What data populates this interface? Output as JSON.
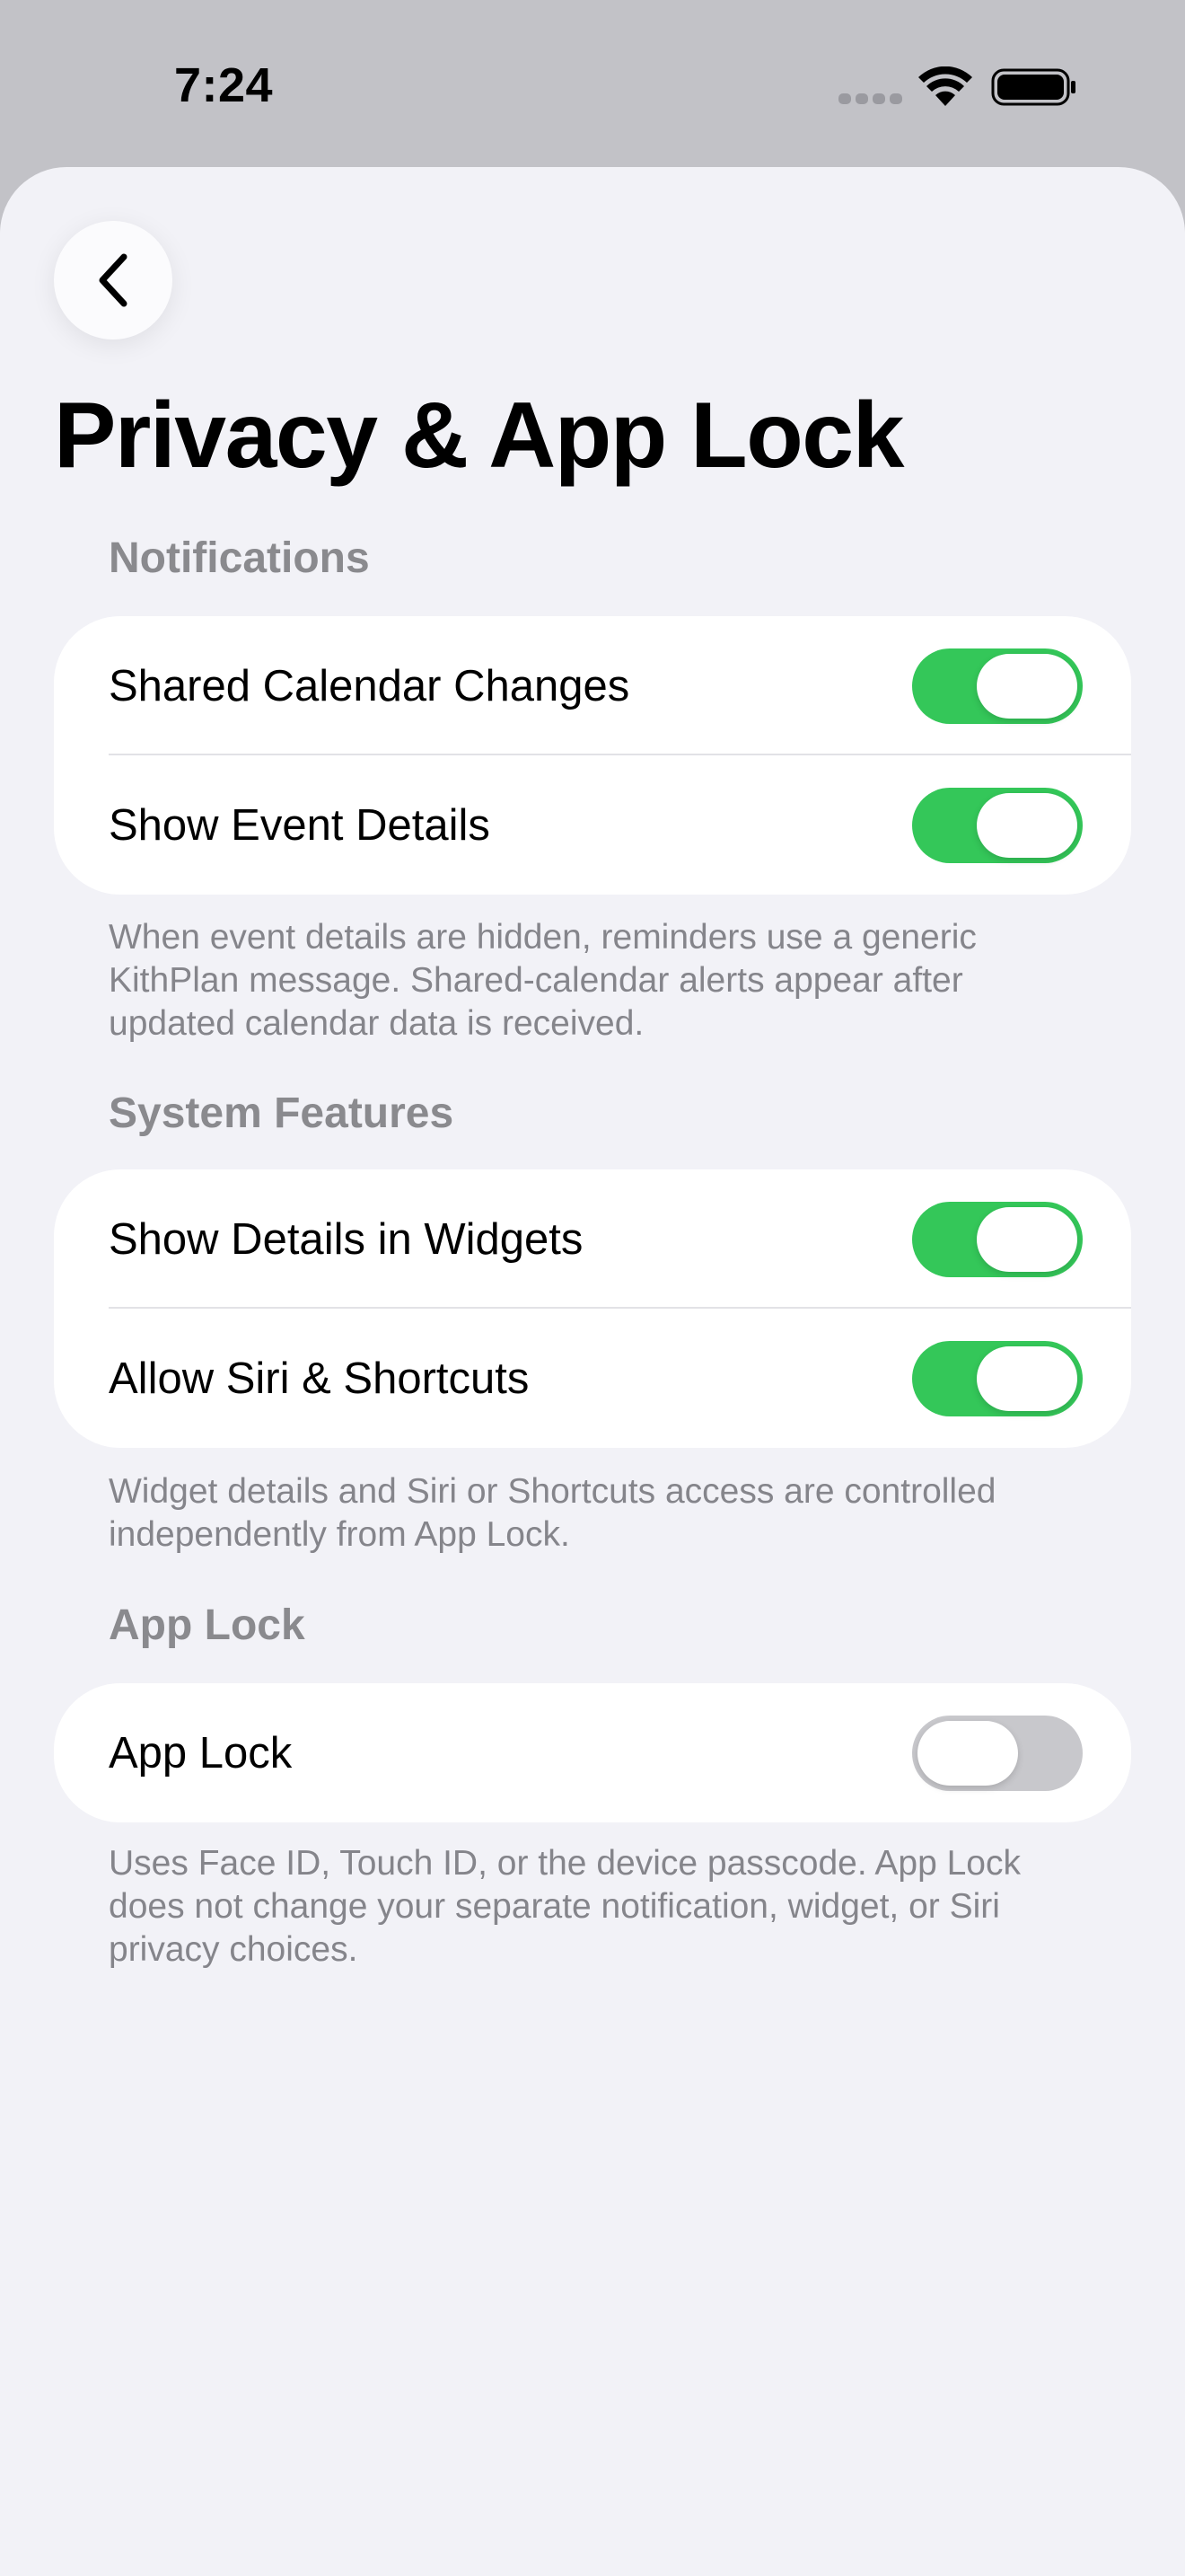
{
  "status_bar": {
    "time": "7:24"
  },
  "page": {
    "title": "Privacy & App Lock"
  },
  "sections": [
    {
      "header": "Notifications",
      "rows": [
        {
          "label": "Shared Calendar Changes",
          "on": true
        },
        {
          "label": "Show Event Details",
          "on": true
        }
      ],
      "footnote": "When event details are hidden, reminders use a generic KithPlan message. Shared-calendar alerts appear after updated calendar data is received."
    },
    {
      "header": "System Features",
      "rows": [
        {
          "label": "Show Details in Widgets",
          "on": true
        },
        {
          "label": "Allow Siri & Shortcuts",
          "on": true
        }
      ],
      "footnote": "Widget details and Siri or Shortcuts access are controlled independently from App Lock."
    },
    {
      "header": "App Lock",
      "rows": [
        {
          "label": "App Lock",
          "on": false
        }
      ],
      "footnote": "Uses Face ID, Touch ID, or the device passcode. App Lock does not change your separate notification, widget, or Siri privacy choices."
    }
  ],
  "colors": {
    "toggle_on": "#34c759",
    "toggle_off": "#c8c8cc",
    "background": "#f2f2f7",
    "secondary_text": "#8a8a8e"
  },
  "icons": {
    "back": "chevron-left-icon",
    "wifi": "wifi-icon",
    "battery": "battery-icon",
    "signal": "cellular-signal-icon"
  }
}
